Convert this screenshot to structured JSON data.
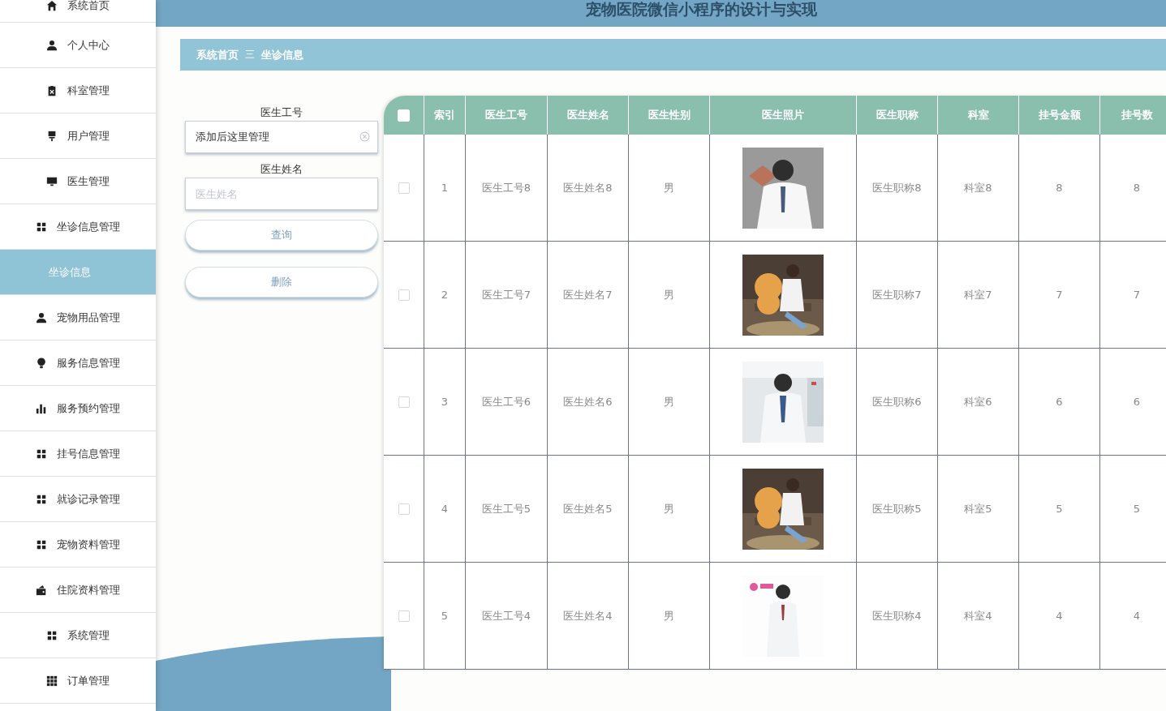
{
  "header": {
    "title": "宠物医院微信小程序的设计与实现"
  },
  "sidebar": {
    "items": [
      {
        "label": "系统首页",
        "selected": false,
        "kind": "menu"
      },
      {
        "label": "个人中心",
        "selected": false,
        "kind": "menu"
      },
      {
        "label": "科室管理",
        "selected": false,
        "kind": "menu"
      },
      {
        "label": "用户管理",
        "selected": false,
        "kind": "menu"
      },
      {
        "label": "医生管理",
        "selected": false,
        "kind": "menu"
      },
      {
        "label": "坐诊信息管理",
        "selected": false,
        "kind": "menu"
      },
      {
        "label": "坐诊信息",
        "selected": true,
        "kind": "submenu"
      },
      {
        "label": "宠物用品管理",
        "selected": false,
        "kind": "menu"
      },
      {
        "label": "服务信息管理",
        "selected": false,
        "kind": "menu"
      },
      {
        "label": "服务预约管理",
        "selected": false,
        "kind": "menu"
      },
      {
        "label": "挂号信息管理",
        "selected": false,
        "kind": "menu"
      },
      {
        "label": "就诊记录管理",
        "selected": false,
        "kind": "menu"
      },
      {
        "label": "宠物资料管理",
        "selected": false,
        "kind": "menu"
      },
      {
        "label": "住院资料管理",
        "selected": false,
        "kind": "menu"
      },
      {
        "label": "系统管理",
        "selected": false,
        "kind": "menu"
      },
      {
        "label": "订单管理",
        "selected": false,
        "kind": "menu"
      }
    ]
  },
  "breadcrumb": {
    "items": [
      "系统首页",
      "坐诊信息"
    ],
    "separator": "三"
  },
  "search": {
    "fields": [
      {
        "label": "医生工号",
        "value": "添加后这里管理"
      },
      {
        "label": "医生姓名",
        "placeholder": "医生姓名"
      }
    ],
    "buttons": [
      "查询",
      "删除"
    ]
  },
  "table": {
    "select_all": false,
    "columns": [
      "索引",
      "医生工号",
      "医生姓名",
      "医生性别",
      "医生照片",
      "医生职称",
      "科室",
      "挂号金额",
      "挂号数"
    ],
    "rows": [
      {
        "checked": false,
        "cells": [
          "1",
          "医生工号8",
          "医生姓名8",
          "男",
          {
            "kind": "picture"
          },
          "医生职称8",
          "科室8",
          "8",
          "8"
        ]
      },
      {
        "checked": false,
        "cells": [
          "2",
          "医生工号7",
          "医生姓名7",
          "男",
          {
            "kind": "picture"
          },
          "医生职称7",
          "科室7",
          "7",
          "7"
        ]
      },
      {
        "checked": false,
        "cells": [
          "3",
          "医生工号6",
          "医生姓名6",
          "男",
          {
            "kind": "picture"
          },
          "医生职称6",
          "科室6",
          "6",
          "6"
        ]
      },
      {
        "checked": false,
        "cells": [
          "4",
          "医生工号5",
          "医生姓名5",
          "男",
          {
            "kind": "picture"
          },
          "医生职称5",
          "科室5",
          "5",
          "5"
        ]
      },
      {
        "checked": false,
        "cells": [
          "5",
          "医生工号4",
          "医生姓名4",
          "男",
          {
            "kind": "picture"
          },
          "医生职称4",
          "科室4",
          "4",
          "4"
        ]
      }
    ]
  }
}
